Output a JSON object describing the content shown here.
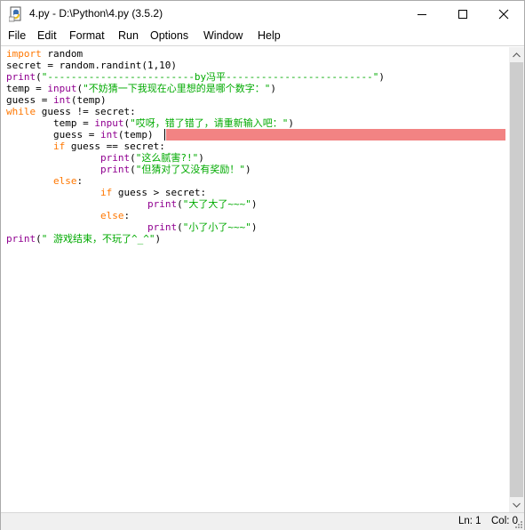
{
  "window": {
    "title": "4.py - D:\\Python\\4.py (3.5.2)"
  },
  "menu": [
    "File",
    "Edit",
    "Format",
    "Run",
    "Options",
    "Window",
    "Help"
  ],
  "code": [
    [
      {
        "t": "import",
        "c": "kw"
      },
      {
        "t": " random",
        "c": ""
      }
    ],
    [
      {
        "t": "secret = random.randint(1,10)",
        "c": ""
      }
    ],
    [
      {
        "t": "print",
        "c": "bi"
      },
      {
        "t": "(",
        "c": ""
      },
      {
        "t": "\"-------------------------by冯平-------------------------\"",
        "c": "str"
      },
      {
        "t": ")",
        "c": ""
      }
    ],
    [
      {
        "t": "temp = ",
        "c": ""
      },
      {
        "t": "input",
        "c": "bi"
      },
      {
        "t": "(",
        "c": ""
      },
      {
        "t": "\"不妨猜一下我现在心里想的是哪个数字：\"",
        "c": "str"
      },
      {
        "t": ")",
        "c": ""
      }
    ],
    [
      {
        "t": "guess = ",
        "c": ""
      },
      {
        "t": "int",
        "c": "bi"
      },
      {
        "t": "(temp)",
        "c": ""
      }
    ],
    [
      {
        "t": "while",
        "c": "kw"
      },
      {
        "t": " guess != secret:",
        "c": ""
      }
    ],
    [
      {
        "t": "        temp = ",
        "c": ""
      },
      {
        "t": "input",
        "c": "bi"
      },
      {
        "t": "(",
        "c": ""
      },
      {
        "t": "\"哎呀，错了错了，请重新输入吧：\"",
        "c": "str"
      },
      {
        "t": ")",
        "c": ""
      }
    ],
    [
      {
        "t": "        guess = ",
        "c": ""
      },
      {
        "t": "int",
        "c": "bi"
      },
      {
        "t": "(temp)",
        "c": ""
      }
    ],
    [
      {
        "t": "        ",
        "c": ""
      },
      {
        "t": "if",
        "c": "kw"
      },
      {
        "t": " guess == secret:",
        "c": ""
      }
    ],
    [
      {
        "t": "                ",
        "c": ""
      },
      {
        "t": "print",
        "c": "bi"
      },
      {
        "t": "(",
        "c": ""
      },
      {
        "t": "\"这么腻害?!\"",
        "c": "str"
      },
      {
        "t": ")",
        "c": ""
      }
    ],
    [
      {
        "t": "                ",
        "c": ""
      },
      {
        "t": "print",
        "c": "bi"
      },
      {
        "t": "(",
        "c": ""
      },
      {
        "t": "\"但猜对了又没有奖励！\"",
        "c": "str"
      },
      {
        "t": ")",
        "c": ""
      }
    ],
    [
      {
        "t": "        ",
        "c": ""
      },
      {
        "t": "else",
        "c": "kw"
      },
      {
        "t": ":",
        "c": ""
      }
    ],
    [
      {
        "t": "                ",
        "c": ""
      },
      {
        "t": "if",
        "c": "kw"
      },
      {
        "t": " guess > secret:",
        "c": ""
      }
    ],
    [
      {
        "t": "                        ",
        "c": ""
      },
      {
        "t": "print",
        "c": "bi"
      },
      {
        "t": "(",
        "c": ""
      },
      {
        "t": "\"大了大了~~~\"",
        "c": "str"
      },
      {
        "t": ")",
        "c": ""
      }
    ],
    [
      {
        "t": "                ",
        "c": ""
      },
      {
        "t": "else",
        "c": "kw"
      },
      {
        "t": ":",
        "c": ""
      }
    ],
    [
      {
        "t": "                        ",
        "c": ""
      },
      {
        "t": "print",
        "c": "bi"
      },
      {
        "t": "(",
        "c": ""
      },
      {
        "t": "\"小了小了~~~\"",
        "c": "str"
      },
      {
        "t": ")",
        "c": ""
      }
    ],
    [
      {
        "t": "print",
        "c": "bi"
      },
      {
        "t": "(",
        "c": ""
      },
      {
        "t": "\" 游戏结束，不玩了^_^\"",
        "c": "str"
      },
      {
        "t": ")",
        "c": ""
      }
    ]
  ],
  "status": {
    "line": "Ln: 1",
    "col": "Col: 0"
  }
}
